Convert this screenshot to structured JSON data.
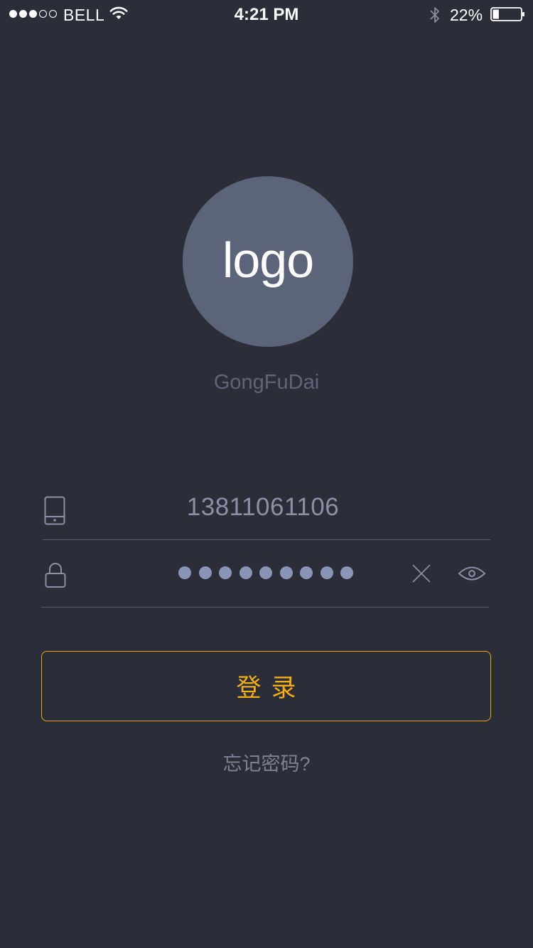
{
  "status_bar": {
    "signal": {
      "full": 3,
      "empty": 2
    },
    "carrier": "BELL",
    "time": "4:21 PM",
    "battery_percent": "22%",
    "battery_level": 0.22,
    "icons": [
      "wifi-icon",
      "bluetooth-icon",
      "battery-icon"
    ]
  },
  "logo": {
    "text": "logo",
    "app_name": "GongFuDai"
  },
  "form": {
    "phone": {
      "icon": "mobile-phone-icon",
      "value": "13811061106"
    },
    "password": {
      "icon": "lock-icon",
      "masked_length": 9,
      "clear_icon": "close-icon",
      "visibility_icon": "eye-icon"
    },
    "login_label": "登录",
    "forgot_label": "忘记密码?"
  },
  "colors": {
    "background": "#2b2e39",
    "logo_circle": "#5c6479",
    "accent": "#f2ae13",
    "muted_text": "#8a90a6"
  }
}
